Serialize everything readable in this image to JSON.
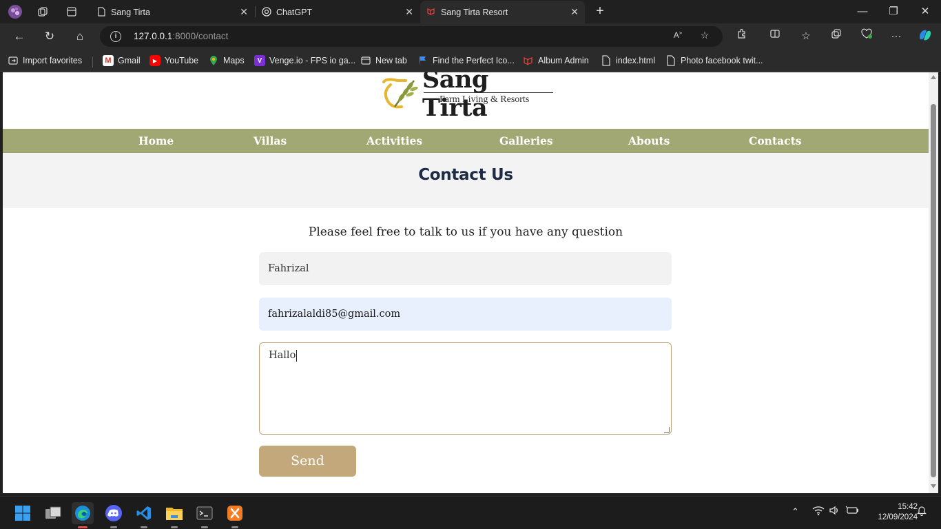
{
  "browser": {
    "tabs": [
      {
        "title": "Sang Tirta",
        "active": false
      },
      {
        "title": "ChatGPT",
        "active": false
      },
      {
        "title": "Sang Tirta Resort",
        "active": true
      }
    ],
    "address": {
      "host": "127.0.0.1",
      "path": ":8000/contact"
    },
    "bookmarks": [
      {
        "label": "Import favorites"
      },
      {
        "label": "Gmail"
      },
      {
        "label": "YouTube"
      },
      {
        "label": "Maps"
      },
      {
        "label": "Venge.io - FPS io ga..."
      },
      {
        "label": "New tab"
      },
      {
        "label": "Find the Perfect Ico..."
      },
      {
        "label": "Album Admin"
      },
      {
        "label": "index.html"
      },
      {
        "label": "Photo facebook twit..."
      }
    ]
  },
  "site": {
    "logo_title": "Sang Tirta",
    "logo_subtitle": "Farm Living & Resorts",
    "nav": [
      "Home",
      "Villas",
      "Activities",
      "Galleries",
      "Abouts",
      "Contacts"
    ],
    "page_title": "Contact Us",
    "intro": "Please feel free to talk to us if you have any question",
    "form": {
      "name_value": "Fahrizal",
      "email_value": "fahrizalaldi85@gmail.com",
      "message_value": "Hallo",
      "send_label": "Send"
    },
    "colors": {
      "nav_bg": "#a2a873",
      "button_bg": "#c2a87a",
      "title_color": "#1d2b45"
    }
  },
  "taskbar": {
    "time": "15:42",
    "date": "12/09/2024"
  }
}
